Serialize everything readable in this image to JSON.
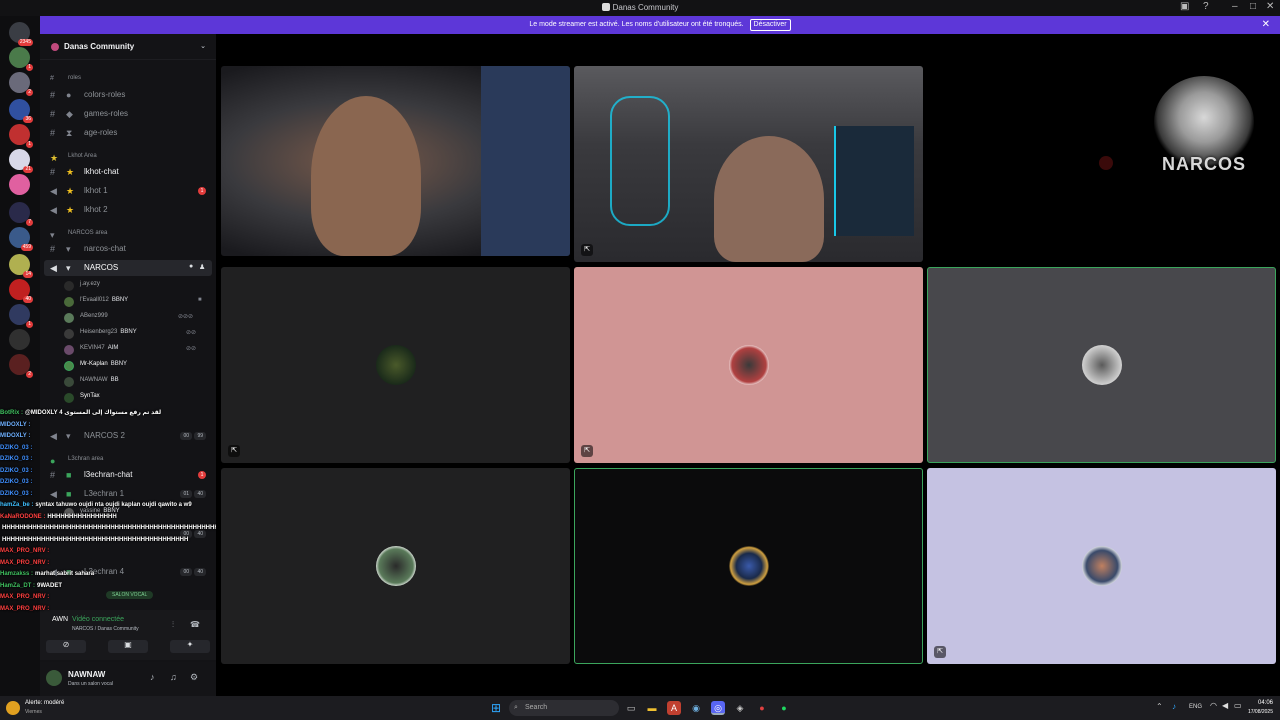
{
  "titlebar": {
    "title": "Danas Community"
  },
  "banner": {
    "text": "Le mode streamer est activé. Les noms d'utilisateur ont été tronqués.",
    "button": "Désactiver"
  },
  "server_badges": [
    "2345",
    "1",
    "2",
    "36",
    "1",
    "21",
    "7",
    "459",
    "14",
    "40",
    "1",
    "2"
  ],
  "guild": {
    "name": "Danas Community"
  },
  "channels": {
    "c1": "roles",
    "c2": "colors-roles",
    "c3": "games-roles",
    "c4": "age-roles",
    "cat_lkhot": "Lkhot Area",
    "c5": "lkhot-chat",
    "c6": "lkhot 1",
    "c7": "lkhot 2",
    "cat_narcos": "NARCOS area",
    "c8": "narcos-chat",
    "c9": "NARCOS",
    "users": [
      "j.ay.ezy",
      "l'Evaall012",
      "ABenz999",
      "Heisenberg23",
      "KEVIN47",
      "Mr-Kaplan",
      "NAWNAW",
      "SynTax"
    ],
    "tags": [
      "BBNY",
      "BBNY",
      "AIM",
      "BBNY",
      "BB"
    ],
    "c10": "NARCOS 2",
    "cat_l3chran": "L3chran area",
    "c11": "l3echran-chat",
    "c12": "L3echran 1",
    "c13": "L3echran 4",
    "user_yassine": "yassine",
    "tag_yassine": "BBNY",
    "counts": [
      "00",
      "99",
      "01",
      "40",
      "00",
      "40",
      "00",
      "40"
    ],
    "unread": [
      "1",
      "1"
    ]
  },
  "voice": {
    "salon": "SALON VOCAL",
    "awn": "AWN",
    "connected": "Vidéo connectée",
    "path": "NARCOS / Danas Community"
  },
  "user": {
    "name": "NAWNAW",
    "status": "Dans un salon vocal"
  },
  "overlay": [
    {
      "u": "BotRix :",
      "m": "@MIDOXLY لقد تم رفع مستواك إلى المستوى 4",
      "c": "#40c060"
    },
    {
      "u": "MIDOXLY :",
      "m": "",
      "c": "#6fb0ff"
    },
    {
      "u": "MIDOXLY :",
      "m": "",
      "c": "#6fb0ff"
    },
    {
      "u": "DZIKO_03 :",
      "m": "",
      "c": "#4090ff"
    },
    {
      "u": "DZIKO_03 :",
      "m": "",
      "c": "#4090ff"
    },
    {
      "u": "DZIKO_03 :",
      "m": "",
      "c": "#4090ff"
    },
    {
      "u": "DZIKO_03 :",
      "m": "",
      "c": "#4090ff"
    },
    {
      "u": "DZIKO_03 :",
      "m": "",
      "c": "#4090ff"
    },
    {
      "u": "hamZa_be :",
      "m": "syntax tahuwo oujdi nta oujdi kaplan oujdi qawito a w9",
      "c": "#40c0ff"
    },
    {
      "u": "KaNaRODONE :",
      "m": "HHHHHHHHHHHHHHHH",
      "c": "#ff4040"
    },
    {
      "u": "",
      "m": "HHHHHHHHHHHHHHHHHHHHHHHHHHHHHHHHHHHHHHHHHHHHHHHHHH",
      "c": "#fff"
    },
    {
      "u": "",
      "m": "HHHHHHHHHHHHHHHHHHHHHHHHHHHHHHHHHHHHHHHHHHH",
      "c": "#fff"
    },
    {
      "u": "MAX_PRO_NRV :",
      "m": "",
      "c": "#ff4040"
    },
    {
      "u": "MAX_PRO_NRV :",
      "m": "",
      "c": "#ff4040"
    },
    {
      "u": "Hamzakss :",
      "m": "marhat sabrit sahara",
      "c": "#40c060"
    },
    {
      "u": "HamZa_DT :",
      "m": "9WADET",
      "c": "#40c060"
    },
    {
      "u": "MAX_PRO_NRV :",
      "m": "",
      "c": "#ff4040"
    },
    {
      "u": "MAX_PRO_NRV :",
      "m": "",
      "c": "#ff4040"
    }
  ],
  "logo": {
    "text": "NARCOS"
  },
  "taskbar": {
    "weather_title": "Alerte: modéré",
    "weather_sub": "Viernes",
    "search": "Search",
    "lang": "ENG",
    "time": "04:06",
    "date": "17/08/2025"
  },
  "colors": {
    "accent": "#5d37d8",
    "tile_pink": "#d09594",
    "tile_lav": "#c5c2e2",
    "tile_dark": "#202021",
    "tile_grey": "#48484c",
    "speaking": "#3ba55c"
  }
}
